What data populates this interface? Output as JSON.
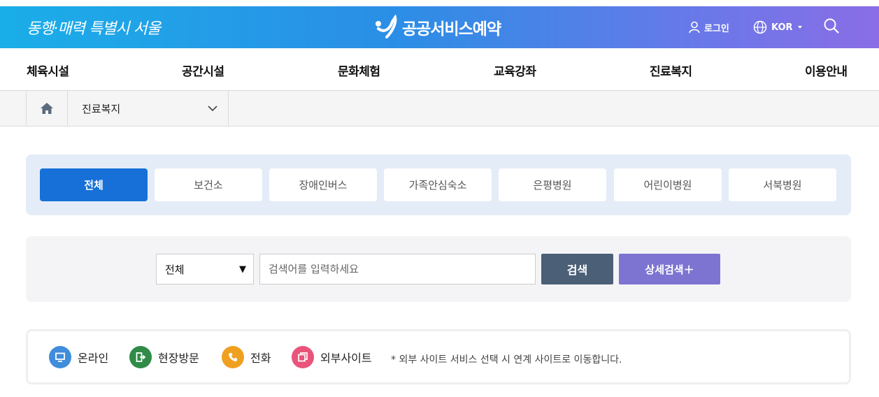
{
  "header": {
    "slogan": "동행·매력 특별시 서울",
    "brand": "공공서비스예약",
    "login": "로그인",
    "language": "KOR"
  },
  "gnb": [
    "체육시설",
    "공간시설",
    "문화체험",
    "교육강좌",
    "진료복지",
    "이용안내"
  ],
  "breadcrumb": {
    "current": "진료복지"
  },
  "tabs": [
    "전체",
    "보건소",
    "장애인버스",
    "가족안심숙소",
    "은평병원",
    "어린이병원",
    "서북병원"
  ],
  "active_tab": "전체",
  "search": {
    "select_value": "전체",
    "placeholder": "검색어를 입력하세요",
    "search_label": "검색",
    "detail_label": "상세검색＋"
  },
  "legend": {
    "items": [
      {
        "label": "온라인",
        "icon": "monitor-icon",
        "color": "#3f8ddb"
      },
      {
        "label": "현장방문",
        "icon": "exit-door-icon",
        "color": "#2f8b47"
      },
      {
        "label": "전화",
        "icon": "phone-icon",
        "color": "#f0a020"
      },
      {
        "label": "외부사이트",
        "icon": "external-window-icon",
        "color": "#e9547a"
      }
    ],
    "note": "* 외부 사이트 서비스 선택 시 연계 사이트로 이동합니다."
  },
  "colors": {
    "active_tab": "#1670d8",
    "search_button": "#4b5f76",
    "detail_button": "#7d74d2"
  }
}
